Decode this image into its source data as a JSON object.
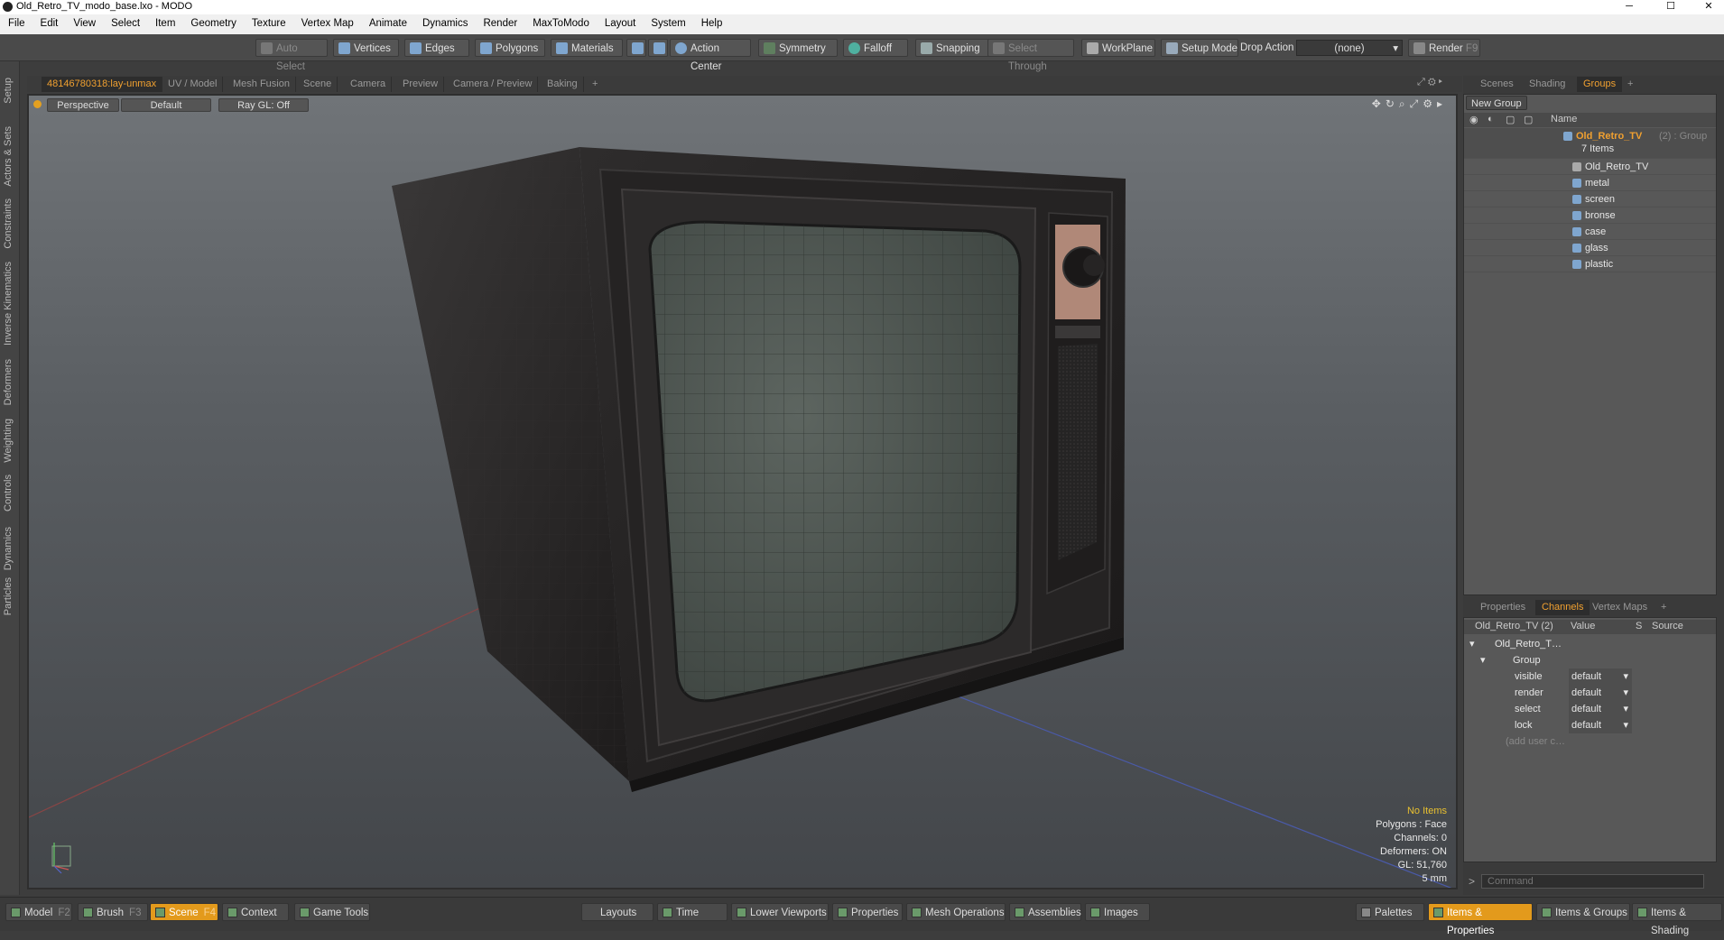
{
  "window": {
    "title": "Old_Retro_TV_modo_base.lxo - MODO",
    "min": "─",
    "max": "☐",
    "close": "✕"
  },
  "menu": [
    "File",
    "Edit",
    "View",
    "Select",
    "Item",
    "Geometry",
    "Texture",
    "Vertex Map",
    "Animate",
    "Dynamics",
    "Render",
    "MaxToModo",
    "Layout",
    "System",
    "Help"
  ],
  "toolbar": {
    "auto_select": "Auto Select",
    "vertices": "Vertices",
    "edges": "Edges",
    "polygons": "Polygons",
    "materials": "Materials",
    "action_center": "Action Center",
    "symmetry": "Symmetry",
    "falloff": "Falloff",
    "snapping": "Snapping",
    "select_through": "Select Through",
    "workplane": "WorkPlane",
    "setup_mode": "Setup Mode",
    "drop_action": "Drop Action",
    "drop_value": "(none)",
    "render": "Render",
    "render_key": "F9"
  },
  "left_tabs": [
    "Setup",
    "Actors & Sets",
    "Constraints",
    "Inverse Kinematics",
    "Deformers",
    "Weighting",
    "Controls",
    "Dynamics",
    "Particles"
  ],
  "viewport_tabs": [
    "48146780318:lay-unmax",
    "UV / Model",
    "Mesh Fusion",
    "Scene",
    "Camera",
    "Preview",
    "Camera / Preview",
    "Baking",
    "+"
  ],
  "viewport": {
    "projection": "Perspective",
    "shading": "Default",
    "raygl": "Ray GL: Off"
  },
  "stats": {
    "selection": "No Items",
    "polygons": "Polygons : Face",
    "channels": "Channels: 0",
    "deformers": "Deformers: ON",
    "gl": "GL: 51,760",
    "scale": "5 mm"
  },
  "right_tabs": [
    "Scenes",
    "Shading",
    "Groups",
    "+"
  ],
  "groups": {
    "new_group": "New Group",
    "name_header": "Name",
    "root": "Old_Retro_TV",
    "root_suffix": "(2) : Group",
    "count": "7 Items",
    "items": [
      "Old_Retro_TV",
      "metal",
      "screen",
      "bronse",
      "case",
      "glass",
      "plastic"
    ]
  },
  "props_tabs": [
    "Properties",
    "Channels",
    "Vertex Maps",
    "+"
  ],
  "channels": {
    "header_item": "Old_Retro_TV (2)",
    "header_value": "Value",
    "header_s": "S",
    "header_source": "Source",
    "root": "Old_Retro_T…",
    "group": "Group",
    "rows": [
      {
        "name": "visible",
        "value": "default"
      },
      {
        "name": "render",
        "value": "default"
      },
      {
        "name": "select",
        "value": "default"
      },
      {
        "name": "lock",
        "value": "default"
      }
    ],
    "add": "(add user c…"
  },
  "command": {
    "prompt": ">",
    "placeholder": "Command"
  },
  "bottom": {
    "model": "Model",
    "model_key": "F2",
    "brush": "Brush",
    "brush_key": "F3",
    "scene": "Scene",
    "scene_key": "F4",
    "context": "Context",
    "game_tools": "Game Tools",
    "layouts": "Layouts",
    "time": "Time",
    "lower_viewports": "Lower Viewports",
    "properties": "Properties",
    "mesh_operations": "Mesh Operations",
    "assemblies": "Assemblies",
    "images": "Images",
    "palettes": "Palettes",
    "items_properties": "Items & Properties",
    "items_groups": "Items & Groups",
    "items_shading": "Items & Shading"
  },
  "colors": {
    "accent": "#f0a030",
    "active_button": "#e39a1c",
    "viewport_top": "#707478",
    "viewport_bottom": "#43464a"
  }
}
